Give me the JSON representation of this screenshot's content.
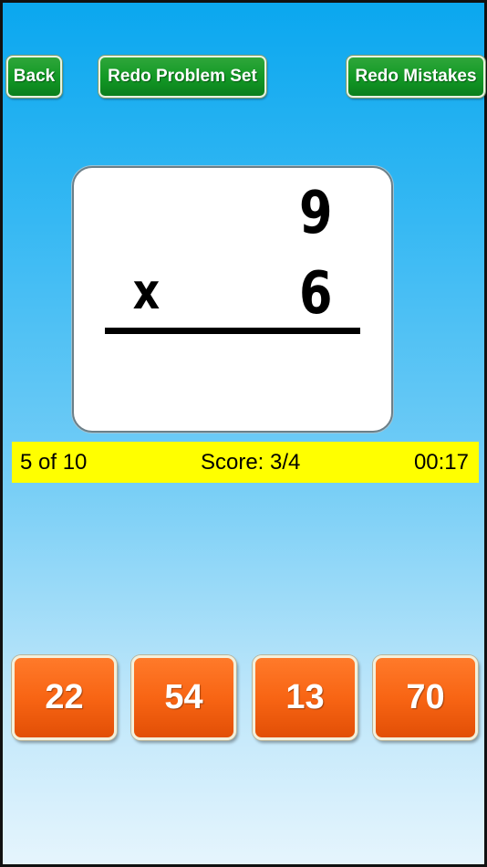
{
  "toolbar": {
    "back_label": "Back",
    "redo_set_label": "Redo Problem Set",
    "redo_mistakes_label": "Redo Mistakes"
  },
  "problem": {
    "top_number": "9",
    "operator": "x",
    "bottom_number": "6"
  },
  "status": {
    "progress": "5 of 10",
    "score": "Score: 3/4",
    "timer": "00:17"
  },
  "answers": [
    {
      "label": "22"
    },
    {
      "label": "54"
    },
    {
      "label": "13"
    },
    {
      "label": "70"
    }
  ],
  "colors": {
    "button_green": "#139a26",
    "answer_orange": "#f86514",
    "status_bar_yellow": "#ffff00",
    "background_top": "#0aa7ef",
    "background_bottom": "#e6f5fd"
  }
}
